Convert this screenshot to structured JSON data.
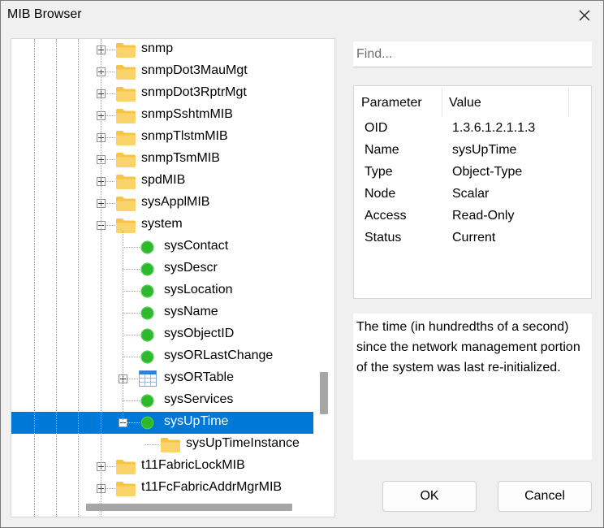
{
  "window": {
    "title": "MIB Browser"
  },
  "tree": {
    "rows": [
      {
        "label": "snmp",
        "icon": "folder-icon",
        "expander": "plus"
      },
      {
        "label": "snmpDot3MauMgt",
        "icon": "folder-icon",
        "expander": "plus"
      },
      {
        "label": "snmpDot3RptrMgt",
        "icon": "folder-icon",
        "expander": "plus"
      },
      {
        "label": "snmpSshtmMIB",
        "icon": "folder-icon",
        "expander": "plus"
      },
      {
        "label": "snmpTlstmMIB",
        "icon": "folder-icon",
        "expander": "plus"
      },
      {
        "label": "snmpTsmMIB",
        "icon": "folder-icon",
        "expander": "plus"
      },
      {
        "label": "spdMIB",
        "icon": "folder-icon",
        "expander": "plus"
      },
      {
        "label": "sysApplMIB",
        "icon": "folder-icon",
        "expander": "plus"
      },
      {
        "label": "system",
        "icon": "folder-icon",
        "expander": "minus"
      },
      {
        "label": "sysContact",
        "icon": "scalar-node-icon"
      },
      {
        "label": "sysDescr",
        "icon": "scalar-node-icon"
      },
      {
        "label": "sysLocation",
        "icon": "scalar-node-icon"
      },
      {
        "label": "sysName",
        "icon": "scalar-node-icon"
      },
      {
        "label": "sysObjectID",
        "icon": "scalar-node-icon"
      },
      {
        "label": "sysORLastChange",
        "icon": "scalar-node-icon"
      },
      {
        "label": "sysORTable",
        "icon": "table-icon",
        "expander": "plus"
      },
      {
        "label": "sysServices",
        "icon": "scalar-node-icon"
      },
      {
        "label": "sysUpTime",
        "icon": "scalar-node-icon",
        "expander": "minus",
        "selected": true
      },
      {
        "label": "sysUpTimeInstance",
        "icon": "folder-icon"
      },
      {
        "label": "t11FabricLockMIB",
        "icon": "folder-icon",
        "expander": "plus"
      },
      {
        "label": "t11FcFabricAddrMgrMIB",
        "icon": "folder-icon",
        "expander": "plus"
      }
    ]
  },
  "search": {
    "placeholder": "Find..."
  },
  "params": {
    "headers": {
      "parameter": "Parameter",
      "value": "Value"
    },
    "rows": [
      {
        "name": "OID",
        "value": "1.3.6.1.2.1.1.3"
      },
      {
        "name": "Name",
        "value": "sysUpTime"
      },
      {
        "name": "Type",
        "value": "Object-Type"
      },
      {
        "name": "Node",
        "value": "Scalar"
      },
      {
        "name": "Access",
        "value": "Read-Only"
      },
      {
        "name": "Status",
        "value": "Current"
      }
    ]
  },
  "description": "The time (in hundredths of a second) since the network management portion of the system was last re-initialized.",
  "buttons": {
    "ok": "OK",
    "cancel": "Cancel"
  },
  "colors": {
    "selection": "#0078d7",
    "folder": "#f8c445",
    "scalar_node": "#2eb82e",
    "table_header": "#2f7fd7"
  }
}
